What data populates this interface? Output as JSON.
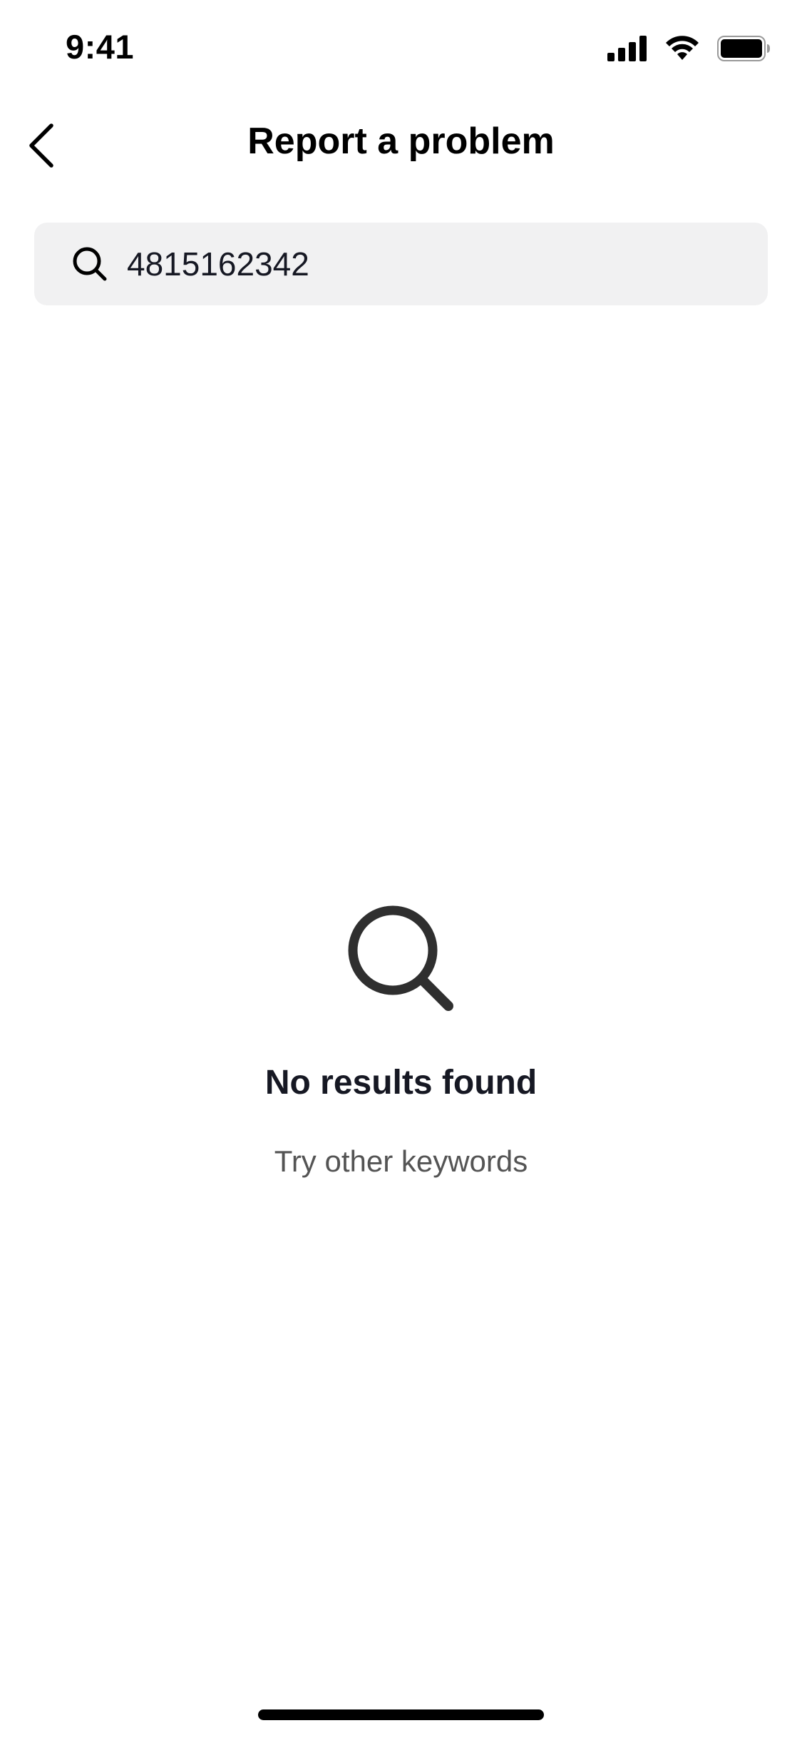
{
  "status_bar": {
    "time": "9:41",
    "icons": [
      "cellular-signal-icon",
      "wifi-icon",
      "battery-icon"
    ]
  },
  "nav": {
    "title": "Report a problem",
    "back_icon": "chevron-left-icon"
  },
  "search": {
    "icon": "search-icon",
    "value": "4815162342"
  },
  "empty_state": {
    "icon": "search-icon",
    "title": "No results found",
    "subtitle": "Try other keywords"
  },
  "colors": {
    "background": "#ffffff",
    "search_background": "#f1f1f2",
    "primary_text": "#161823",
    "secondary_text": "#545454"
  }
}
